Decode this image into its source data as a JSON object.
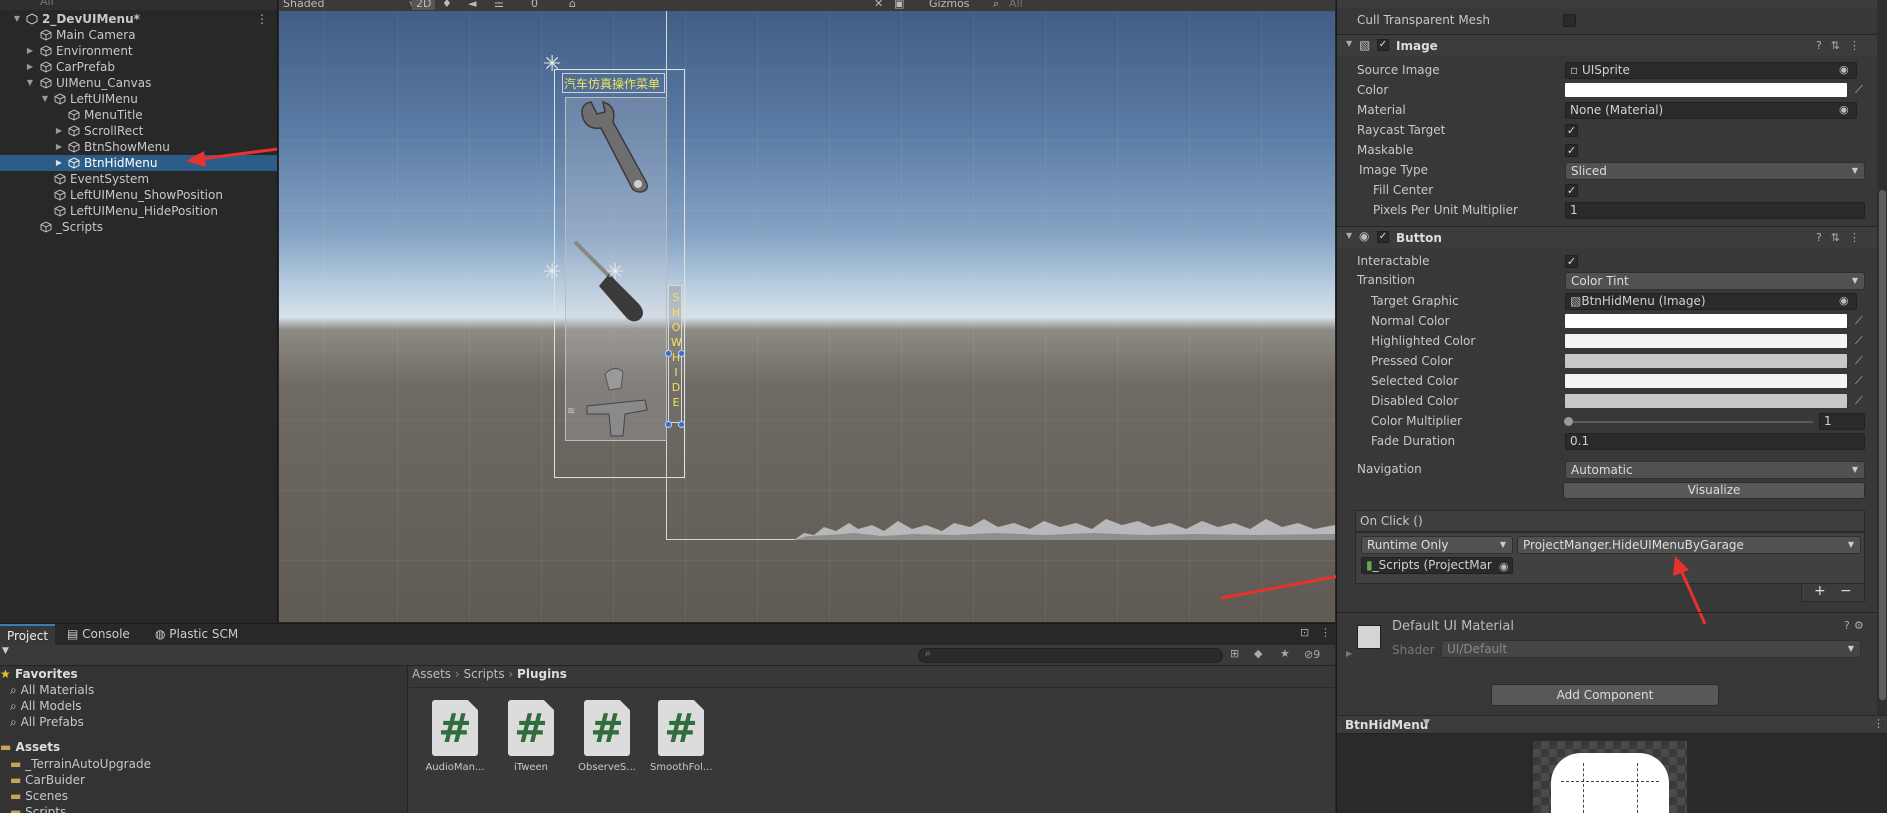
{
  "hierarchy": {
    "search_placeholder": "All",
    "items": [
      {
        "label": "2_DevUIMenu*"
      },
      {
        "label": "Main Camera"
      },
      {
        "label": "Environment"
      },
      {
        "label": "CarPrefab"
      },
      {
        "label": "UIMenu_Canvas"
      },
      {
        "label": "LeftUIMenu"
      },
      {
        "label": "MenuTitle"
      },
      {
        "label": "ScrollRect"
      },
      {
        "label": "BtnShowMenu"
      },
      {
        "label": "BtnHidMenu"
      },
      {
        "label": "EventSystem"
      },
      {
        "label": "LeftUIMenu_ShowPosition"
      },
      {
        "label": "LeftUIMenu_HidePosition"
      },
      {
        "label": "_Scripts"
      }
    ]
  },
  "scene_toolbar": {
    "shading": "Shaded",
    "mode": "2D",
    "gizmos": "Gizmos",
    "search_placeholder": "All",
    "hidden_count": "0"
  },
  "scene": {
    "menu_title": "汽车仿真操作菜单",
    "show_hide": "SHOWHIDE"
  },
  "inspector": {
    "cull_transparent": "Cull Transparent Mesh",
    "image": {
      "title": "Image",
      "source_image_label": "Source Image",
      "source_image_value": "UISprite",
      "color_label": "Color",
      "material_label": "Material",
      "material_value": "None (Material)",
      "raycast_label": "Raycast Target",
      "maskable_label": "Maskable",
      "image_type_label": "Image Type",
      "image_type_value": "Sliced",
      "fill_center_label": "Fill Center",
      "ppu_label": "Pixels Per Unit Multiplier",
      "ppu_value": "1"
    },
    "button": {
      "title": "Button",
      "interactable_label": "Interactable",
      "transition_label": "Transition",
      "transition_value": "Color Tint",
      "target_graphic_label": "Target Graphic",
      "target_graphic_value": "BtnHidMenu  (Image)",
      "normal_label": "Normal Color",
      "highlighted_label": "Highlighted Color",
      "pressed_label": "Pressed Color",
      "selected_label": "Selected Color",
      "disabled_label": "Disabled Color",
      "multiplier_label": "Color Multiplier",
      "multiplier_value": "1",
      "fade_label": "Fade Duration",
      "fade_value": "0.1",
      "navigation_label": "Navigation",
      "navigation_value": "Automatic",
      "visualize_label": "Visualize",
      "onclick_label": "On Click ()",
      "runtime_value": "Runtime Only",
      "function_value": "ProjectManger.HideUIMenuByGarage",
      "object_value": "_Scripts (ProjectMar",
      "plus": "+",
      "minus": "−"
    },
    "material": {
      "title": "Default UI Material",
      "shader_label": "Shader",
      "shader_value": "UI/Default"
    },
    "add_component": "Add Component",
    "preview_title": "BtnHidMenu"
  },
  "project": {
    "tabs": [
      "Project",
      "Console",
      "Plastic SCM"
    ],
    "favorites_label": "Favorites",
    "favorites": [
      "All Materials",
      "All Models",
      "All Prefabs"
    ],
    "assets_label": "Assets",
    "folders": [
      "_TerrainAutoUpgrade",
      "CarBuider",
      "Scenes",
      "Scripts"
    ],
    "breadcrumb": [
      "Assets",
      "Scripts",
      "Plugins"
    ],
    "hidden_count": "9",
    "files": [
      {
        "name": "AudioMan...",
        "glyph": "#"
      },
      {
        "name": "iTween",
        "glyph": "#"
      },
      {
        "name": "ObserveS...",
        "glyph": "#"
      },
      {
        "name": "SmoothFol...",
        "glyph": "#"
      }
    ]
  },
  "colors": {
    "selection": "#2c5d87",
    "arrow": "#e8322c",
    "canvas_outline": "#d8d8d8",
    "script_green": "#2f6d3a"
  }
}
